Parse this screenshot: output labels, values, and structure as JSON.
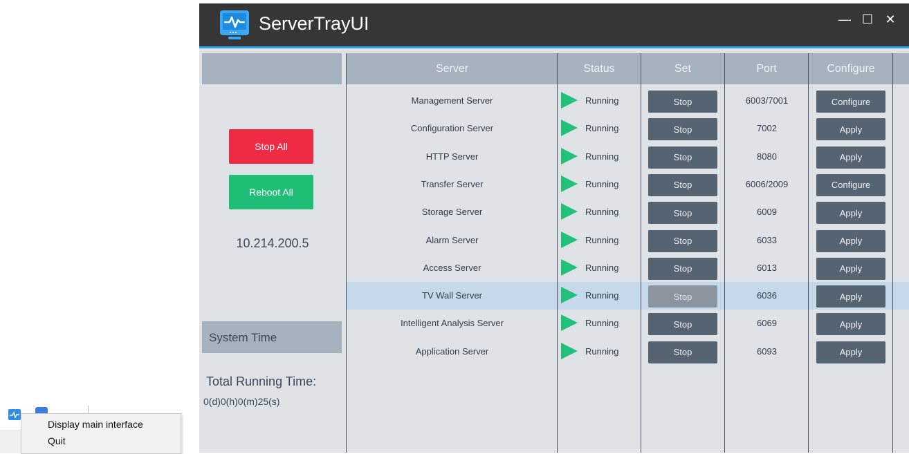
{
  "window": {
    "title": "ServerTrayUI",
    "minimize_glyph": "—",
    "maximize_glyph": "☐",
    "close_glyph": "✕"
  },
  "left_panel": {
    "stop_all_label": "Stop All",
    "reboot_all_label": "Reboot All",
    "ip_address": "10.214.200.5",
    "system_time_header": "System Time",
    "total_running_time_label": "Total Running Time:",
    "total_running_time_value": "0(d)0(h)0(m)25(s)"
  },
  "table": {
    "headers": [
      "Server",
      "Status",
      "Set",
      "Port",
      "Configure"
    ],
    "rows": [
      {
        "name": "Management Server",
        "status": "Running",
        "set": "Stop",
        "port": "6003/7001",
        "configure": "Configure"
      },
      {
        "name": "Configuration Server",
        "status": "Running",
        "set": "Stop",
        "port": "7002",
        "configure": "Apply"
      },
      {
        "name": "HTTP Server",
        "status": "Running",
        "set": "Stop",
        "port": "8080",
        "configure": "Apply"
      },
      {
        "name": "Transfer Server",
        "status": "Running",
        "set": "Stop",
        "port": "6006/2009",
        "configure": "Configure"
      },
      {
        "name": "Storage Server",
        "status": "Running",
        "set": "Stop",
        "port": "6009",
        "configure": "Apply"
      },
      {
        "name": "Alarm Server",
        "status": "Running",
        "set": "Stop",
        "port": "6033",
        "configure": "Apply"
      },
      {
        "name": "Access Server",
        "status": "Running",
        "set": "Stop",
        "port": "6013",
        "configure": "Apply"
      },
      {
        "name": "TV Wall Server",
        "status": "Running",
        "set": "Stop",
        "port": "6036",
        "configure": "Apply"
      },
      {
        "name": "Intelligent Analysis Server",
        "status": "Running",
        "set": "Stop",
        "port": "6069",
        "configure": "Apply"
      },
      {
        "name": "Application Server",
        "status": "Running",
        "set": "Stop",
        "port": "6093",
        "configure": "Apply"
      }
    ]
  },
  "context_menu": {
    "items": [
      "Display main interface",
      "Quit"
    ]
  },
  "colors": {
    "titlebar": "#363636",
    "accent": "#2c9fe3",
    "stop_all": "#ef2a45",
    "reboot_all": "#1fbe76",
    "running": "#22c07a",
    "button": "#566370",
    "header": "#a6b3bf"
  },
  "icons": {
    "app": "monitor-pulse-icon",
    "status": "play-triangle-icon"
  }
}
